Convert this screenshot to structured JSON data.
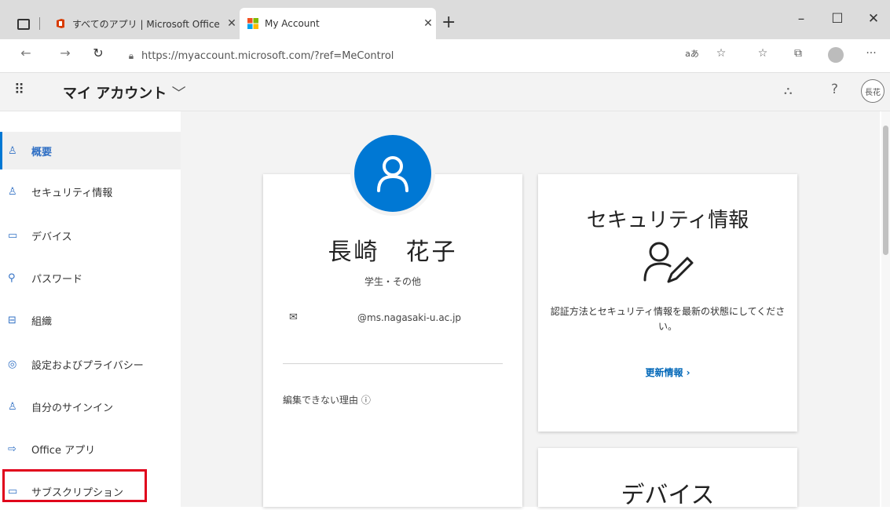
{
  "browser": {
    "tabs": [
      {
        "title": "すべてのアプリ | Microsoft Office",
        "favicon": "office-icon"
      },
      {
        "title": "My Account",
        "favicon": "microsoft-icon"
      }
    ],
    "url": "https://myaccount.microsoft.com/?ref=MeControl",
    "new_tab": "+",
    "controls": {
      "minimize": "–",
      "maximize": "☐",
      "close": "✕"
    },
    "toolbar": {
      "read_aloud": "aあ",
      "more": "···"
    }
  },
  "header": {
    "app_title": "マイ アカウント",
    "avatar_initials": "長花"
  },
  "sidebar": {
    "items": [
      {
        "label": "概要",
        "icon": "person-icon",
        "active": true
      },
      {
        "label": "セキュリティ情報",
        "icon": "security-info-icon"
      },
      {
        "label": "デバイス",
        "icon": "laptop-icon"
      },
      {
        "label": "パスワード",
        "icon": "key-icon"
      },
      {
        "label": "組織",
        "icon": "briefcase-icon"
      },
      {
        "label": "設定およびプライバシー",
        "icon": "settings-icon"
      },
      {
        "label": "自分のサインイン",
        "icon": "signin-icon"
      },
      {
        "label": "Office アプリ",
        "icon": "office-apps-icon"
      },
      {
        "label": "サブスクリプション",
        "icon": "subscription-icon",
        "highlighted": true
      }
    ]
  },
  "profile": {
    "name": "長崎　花子",
    "role": "学生・その他",
    "email": "@ms.nagasaki-u.ac.jp",
    "why_no_edit": "編集できない理由 ⓘ"
  },
  "security_card": {
    "title": "セキュリティ情報",
    "description": "認証方法とセキュリティ情報を最新の状態にしてください。",
    "link": "更新情報 ›"
  },
  "devices_card": {
    "title": "デバイス"
  },
  "colors": {
    "accent": "#0078d4",
    "highlight_box": "#e0001b",
    "link": "#0067b8"
  }
}
